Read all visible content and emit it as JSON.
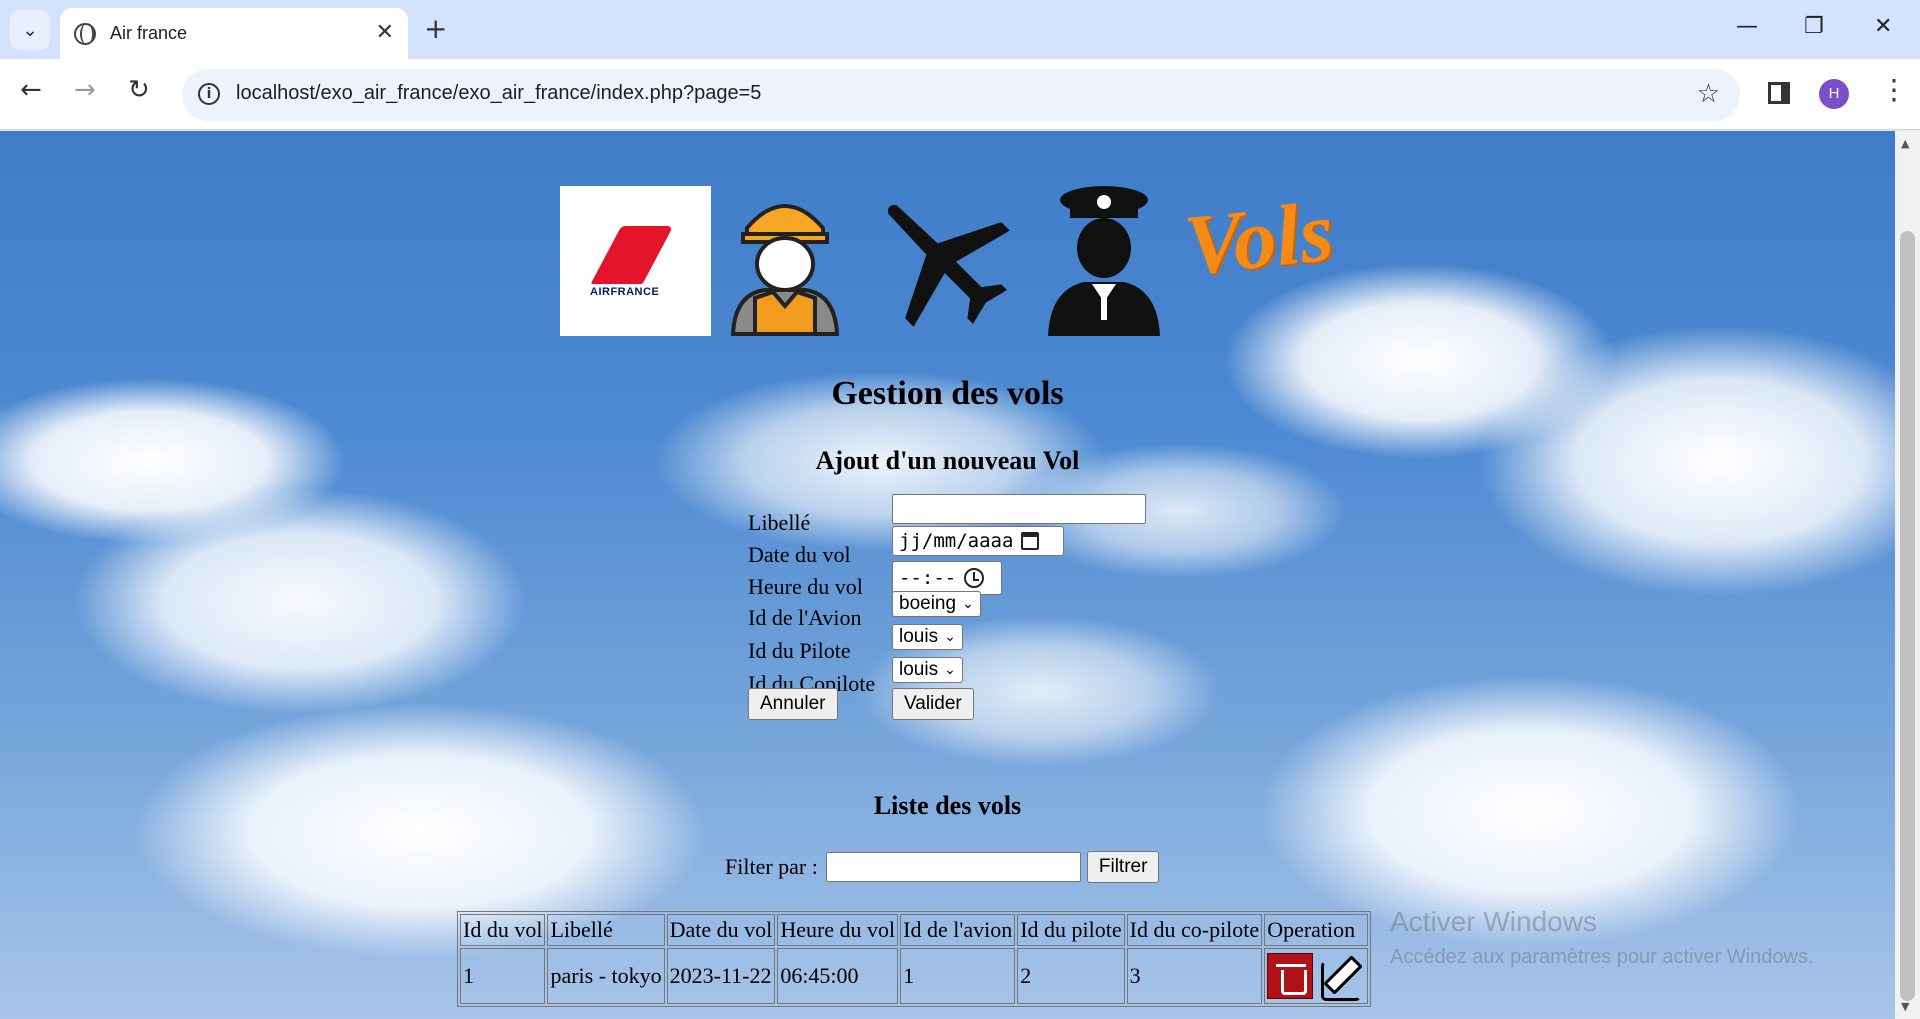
{
  "browser": {
    "tab_title": "Air france",
    "url": "localhost/exo_air_france/exo_air_france/index.php?page=5",
    "profile_initial": "H"
  },
  "header": {
    "logos": [
      {
        "name": "air-france-logo",
        "text": "AIRFRANCE"
      },
      {
        "name": "worker-icon"
      },
      {
        "name": "airplane-icon"
      },
      {
        "name": "pilot-icon"
      },
      {
        "name": "vols-logo",
        "text": "Vols"
      }
    ]
  },
  "main": {
    "title": "Gestion des vols",
    "form_title": "Ajout d'un nouveau Vol",
    "form": {
      "libelle_label": "Libellé",
      "libelle_value": "",
      "date_label": "Date du vol",
      "date_placeholder": "jj/mm/aaaa",
      "time_label": "Heure du vol",
      "time_placeholder": "--:--",
      "avion_label": "Id de l'Avion",
      "avion_value": "boeing",
      "pilote_label": "Id du Pilote",
      "pilote_value": "louis",
      "copilote_label": "Id du Copilote",
      "copilote_value": "louis",
      "cancel_label": "Annuler",
      "submit_label": "Valider"
    },
    "list_title": "Liste des vols",
    "filter": {
      "label": "Filter par :",
      "value": "",
      "button_label": "Filtrer"
    },
    "table": {
      "headers": [
        "Id du vol",
        "Libellé",
        "Date du vol",
        "Heure du vol",
        "Id de l'avion",
        "Id du pilote",
        "Id du co-pilote",
        "Operation"
      ],
      "rows": [
        [
          "1",
          "paris - tokyo",
          "2023-11-22",
          "06:45:00",
          "1",
          "2",
          "3"
        ]
      ]
    }
  },
  "watermark": {
    "line1": "Activer Windows",
    "line2": "Accédez aux paramètres pour activer Windows."
  },
  "colors": {
    "accent_red": "#b01217",
    "vols_orange": "#f58a16",
    "chrome_blue": "#d3e3fd"
  }
}
